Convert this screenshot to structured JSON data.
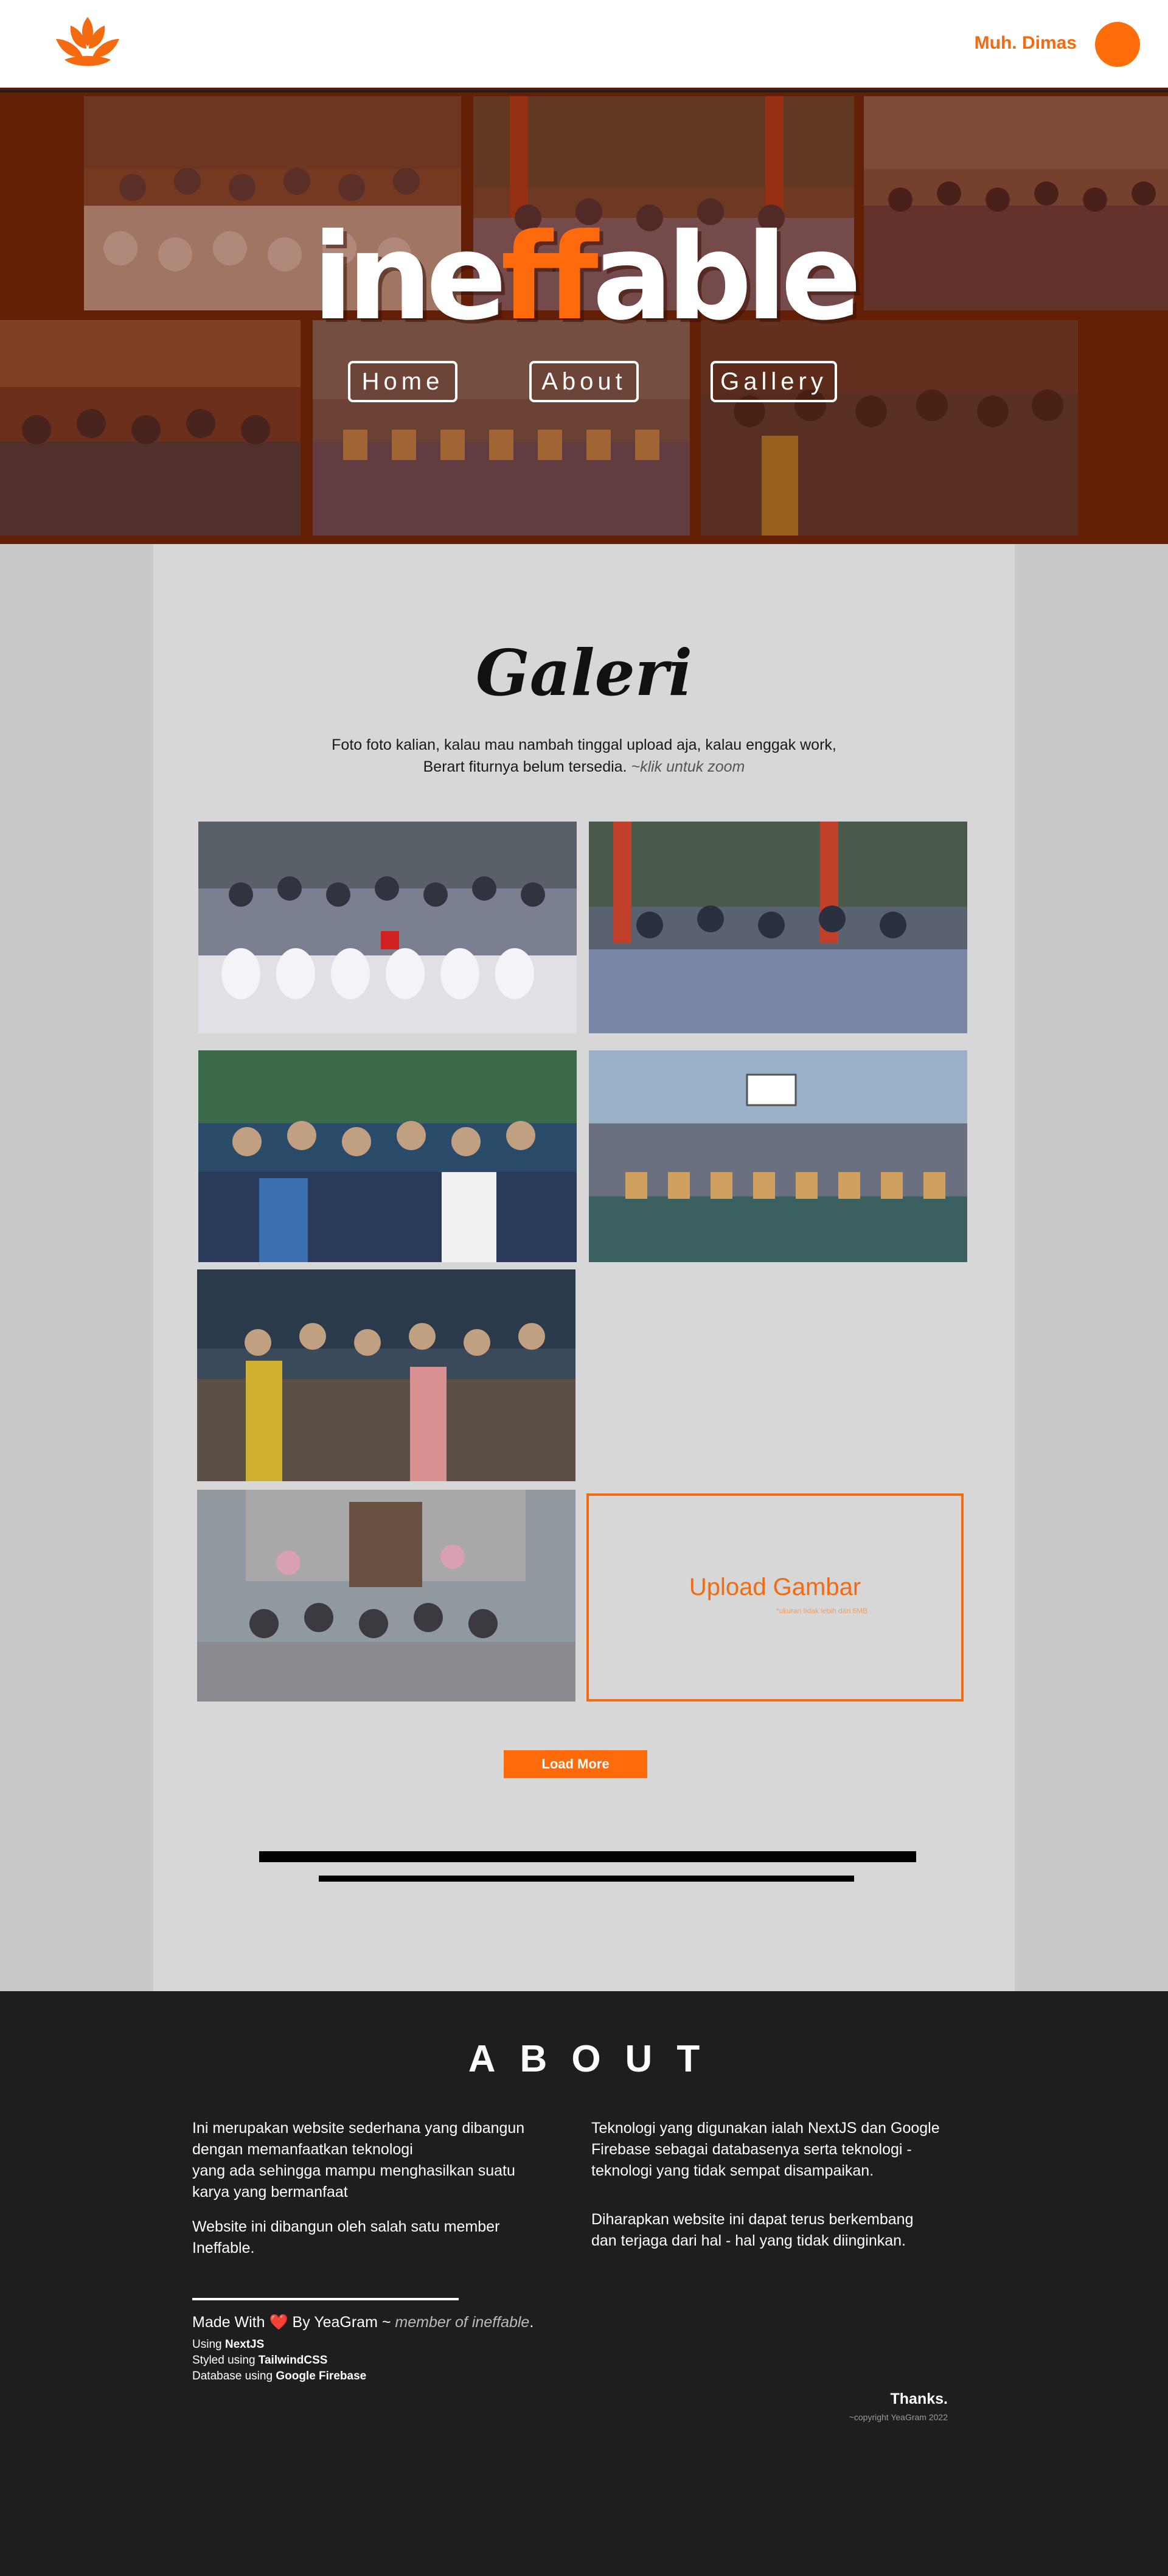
{
  "header": {
    "logo_icon": "lotus-logo-icon",
    "user_name": "Muh. Dimas",
    "avatar_icon": "user-avatar-icon",
    "brand_color": "#f36a10"
  },
  "hero": {
    "title_left": "ine",
    "title_ff": "ff",
    "title_right": "able",
    "nav": {
      "home": "Home",
      "about": "About",
      "gallery": "Gallery"
    }
  },
  "gallery": {
    "title": "Galeri",
    "desc_line1": "Foto foto kalian, kalau mau nambah tinggal upload aja, kalau enggak work,",
    "desc_line2": "Berart fiturnya belum tersedia.",
    "hint": "~klik untuk zoom",
    "upload_title": "Upload Gambar",
    "upload_sub": "*ukuran tidak lebih dari 6MB",
    "load_more": "Load More"
  },
  "about": {
    "title": "ABOUT",
    "left_p1_l1": "Ini merupakan website sederhana  yang dibangun",
    "left_p1_l2": "dengan memanfaatkan teknologi",
    "left_p1_l3": "yang ada sehingga mampu menghasilkan suatu",
    "left_p1_l4": "karya yang bermanfaat",
    "left_p2_l1": "Website ini dibangun oleh salah satu member",
    "left_p2_l2": "Ineffable.",
    "right_p1_l1": "Teknologi yang digunakan ialah NextJS dan Google",
    "right_p1_l2": "Firebase sebagai databasenya serta teknologi -",
    "right_p1_l3": "teknologi yang tidak sempat disampaikan.",
    "right_p2_l1": "Diharapkan website ini dapat terus berkembang",
    "right_p2_l2": "dan terjaga dari hal - hal yang tidak diinginkan.",
    "made_with_prefix": "Made With",
    "heart": "❤️",
    "made_with_by": "By YeaGram ~",
    "member": "member of ineffable",
    "dot": ".",
    "using_label": "Using",
    "using_value": "NextJS",
    "styled_label": "Styled using",
    "styled_value": "TailwindCSS",
    "db_label": "Database using",
    "db_value": "Google Firebase",
    "thanks": "Thanks.",
    "copyright": "~copyright YeaGram 2022"
  }
}
